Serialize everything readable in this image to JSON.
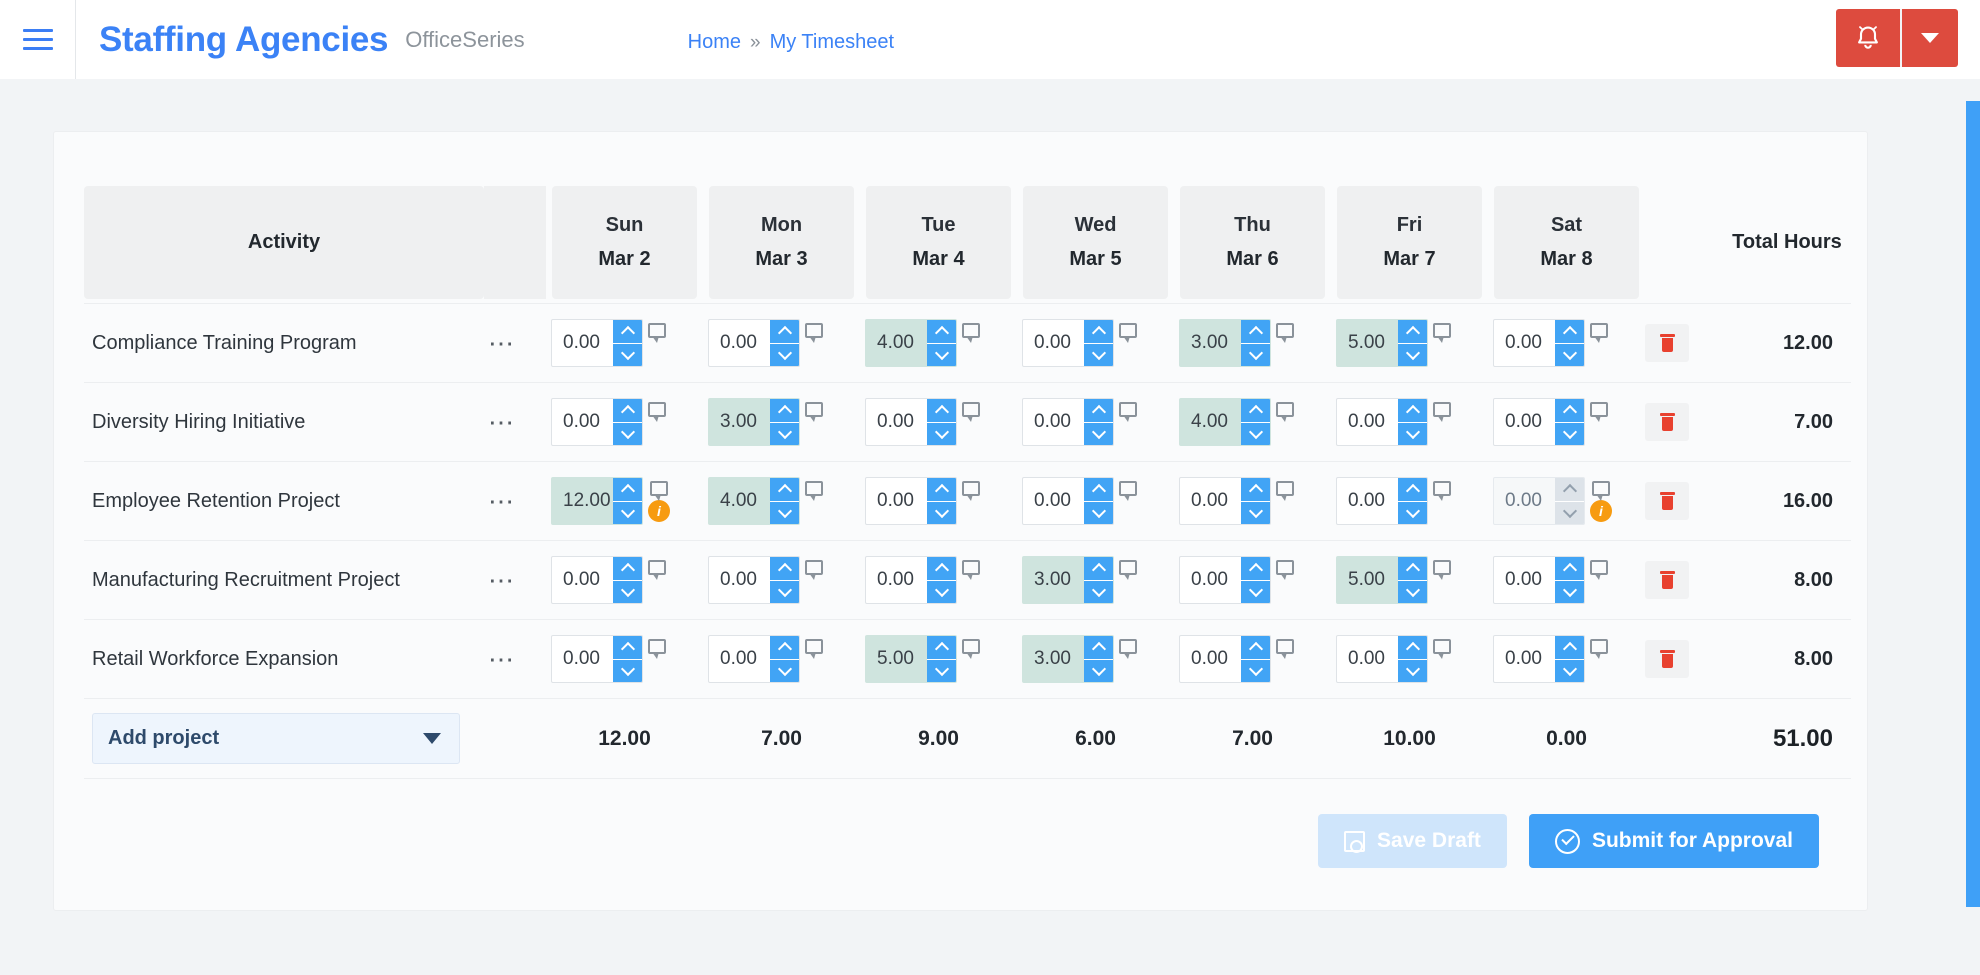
{
  "header": {
    "menu_icon": "hamburger-icon",
    "brand_title": "Staffing Agencies",
    "brand_subtitle": "OfficeSeries",
    "breadcrumb": {
      "home": "Home",
      "separator": "»",
      "current": "My Timesheet"
    },
    "notification_icon": "bell-icon",
    "notification_caret_icon": "chevron-down-icon",
    "accent_red": "#dd4b3e",
    "accent_blue": "#3b82f6"
  },
  "table": {
    "activity_header": "Activity",
    "total_header": "Total Hours",
    "days": [
      {
        "dow": "Sun",
        "date": "Mar 2"
      },
      {
        "dow": "Mon",
        "date": "Mar 3"
      },
      {
        "dow": "Tue",
        "date": "Mar 4"
      },
      {
        "dow": "Wed",
        "date": "Mar 5"
      },
      {
        "dow": "Thu",
        "date": "Mar 6"
      },
      {
        "dow": "Fri",
        "date": "Mar 7"
      },
      {
        "dow": "Sat",
        "date": "Mar 8"
      }
    ],
    "menu_icon": "ellipsis-icon",
    "comment_icon": "comment-icon",
    "warning_icon": "info-warning-icon",
    "delete_icon": "trash-icon",
    "spin_up_icon": "chevron-up-icon",
    "spin_down_icon": "chevron-down-icon",
    "filled_cell_color": "#cfe4de",
    "warning_color": "#f79b10",
    "rows": [
      {
        "activity": "Compliance Training Program",
        "values": [
          "0.00",
          "0.00",
          "4.00",
          "0.00",
          "3.00",
          "5.00",
          "0.00"
        ],
        "filled": [
          false,
          false,
          true,
          false,
          true,
          true,
          false
        ],
        "disabled": [
          false,
          false,
          false,
          false,
          false,
          false,
          false
        ],
        "warnings": [
          false,
          false,
          false,
          false,
          false,
          false,
          false
        ],
        "total": "12.00"
      },
      {
        "activity": "Diversity Hiring Initiative",
        "values": [
          "0.00",
          "3.00",
          "0.00",
          "0.00",
          "4.00",
          "0.00",
          "0.00"
        ],
        "filled": [
          false,
          true,
          false,
          false,
          true,
          false,
          false
        ],
        "disabled": [
          false,
          false,
          false,
          false,
          false,
          false,
          false
        ],
        "warnings": [
          false,
          false,
          false,
          false,
          false,
          false,
          false
        ],
        "total": "7.00"
      },
      {
        "activity": "Employee Retention Project",
        "values": [
          "12.00",
          "4.00",
          "0.00",
          "0.00",
          "0.00",
          "0.00",
          "0.00"
        ],
        "filled": [
          true,
          true,
          false,
          false,
          false,
          false,
          false
        ],
        "disabled": [
          false,
          false,
          false,
          false,
          false,
          false,
          true
        ],
        "warnings": [
          true,
          false,
          false,
          false,
          false,
          false,
          true
        ],
        "total": "16.00"
      },
      {
        "activity": "Manufacturing Recruitment Project",
        "values": [
          "0.00",
          "0.00",
          "0.00",
          "3.00",
          "0.00",
          "5.00",
          "0.00"
        ],
        "filled": [
          false,
          false,
          false,
          true,
          false,
          true,
          false
        ],
        "disabled": [
          false,
          false,
          false,
          false,
          false,
          false,
          false
        ],
        "warnings": [
          false,
          false,
          false,
          false,
          false,
          false,
          false
        ],
        "total": "8.00"
      },
      {
        "activity": "Retail Workforce Expansion",
        "values": [
          "0.00",
          "0.00",
          "5.00",
          "3.00",
          "0.00",
          "0.00",
          "0.00"
        ],
        "filled": [
          false,
          false,
          true,
          true,
          false,
          false,
          false
        ],
        "disabled": [
          false,
          false,
          false,
          false,
          false,
          false,
          false
        ],
        "warnings": [
          false,
          false,
          false,
          false,
          false,
          false,
          false
        ],
        "total": "8.00"
      }
    ],
    "add_project_label": "Add project",
    "add_project_caret_icon": "chevron-down-icon",
    "column_totals": [
      "12.00",
      "7.00",
      "9.00",
      "6.00",
      "7.00",
      "10.00",
      "0.00"
    ],
    "grand_total": "51.00"
  },
  "actions": {
    "save_draft_label": "Save Draft",
    "save_draft_icon": "floppy-disk-icon",
    "save_draft_disabled": true,
    "submit_label": "Submit for Approval",
    "submit_icon": "check-circle-icon"
  }
}
